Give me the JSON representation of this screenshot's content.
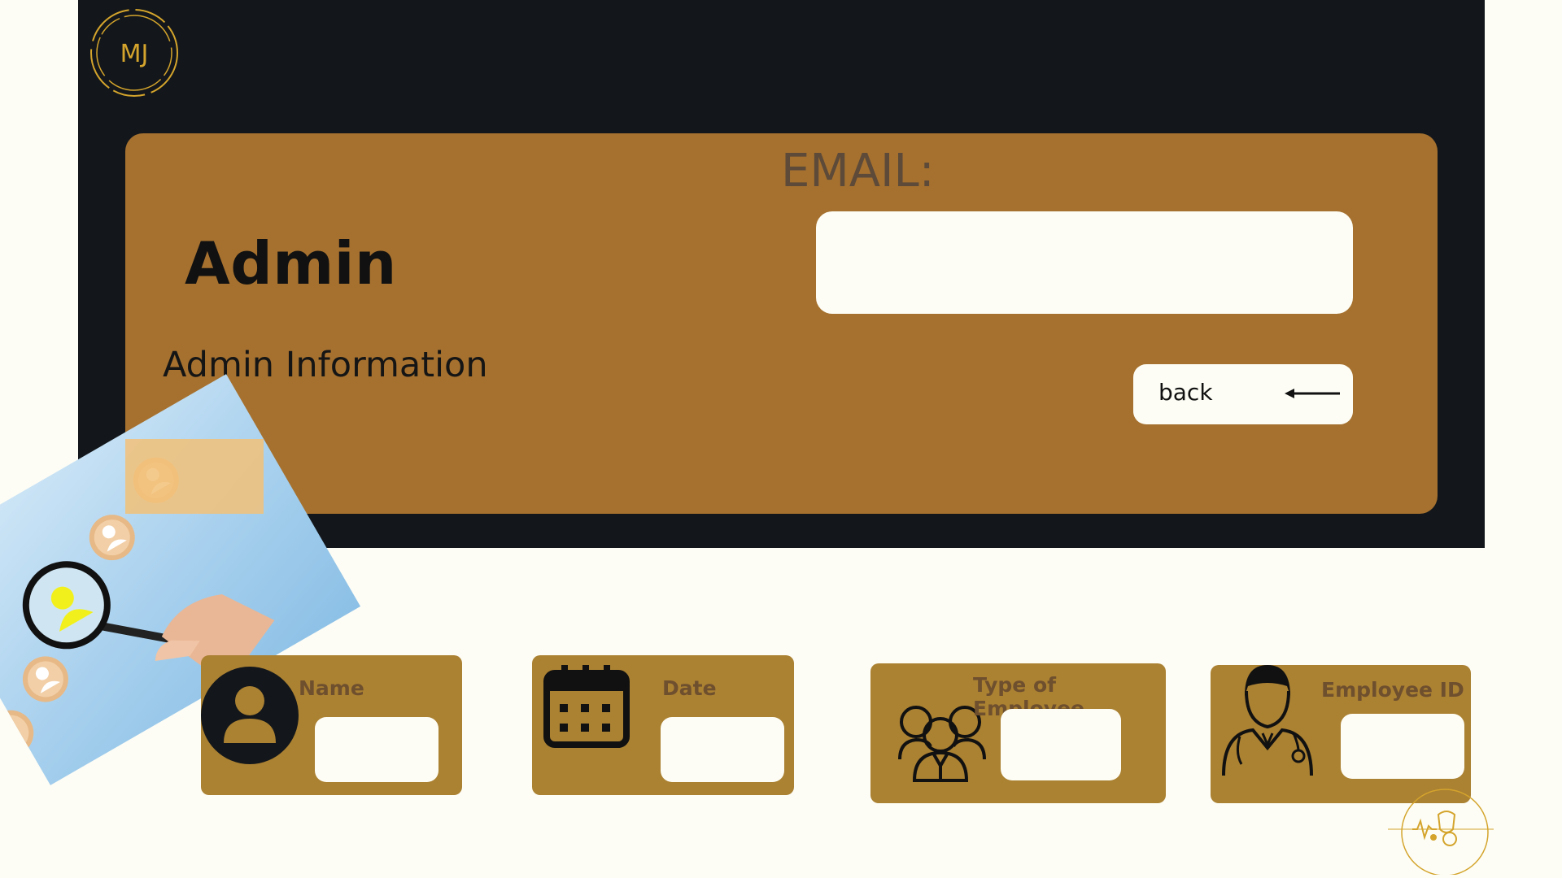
{
  "logo": {
    "text": "MJ"
  },
  "header": {
    "title": "Admin",
    "subtitle": "Admin Information"
  },
  "email": {
    "label": "EMAIL:",
    "value": ""
  },
  "back_button": {
    "label": "back"
  },
  "cards": {
    "name": {
      "label": "Name",
      "value": ""
    },
    "date": {
      "label": "Date",
      "value": ""
    },
    "type": {
      "label": "Type of Employee",
      "value": ""
    },
    "employee_id": {
      "label": "Employee ID",
      "value": ""
    }
  },
  "icons": {
    "name": "user-icon",
    "date": "calendar-icon",
    "type": "group-icon",
    "employee_id": "doctor-icon",
    "back": "arrow-left-icon"
  },
  "colors": {
    "background": "#fdfdf5",
    "dark_panel": "#13171b",
    "card_brown": "#a6712f",
    "field_card": "#ab8132",
    "gold": "#d4a42c"
  }
}
